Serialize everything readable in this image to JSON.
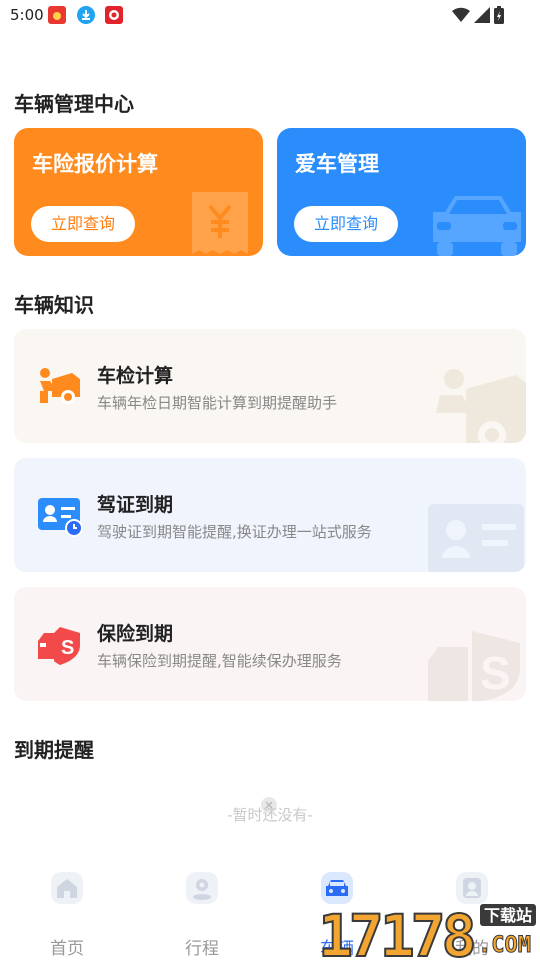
{
  "status_bar": {
    "time": "5:00"
  },
  "section_vehicle_mgmt": "车辆管理中心",
  "top_cards": [
    {
      "title": "车险报价计算",
      "button": "立即查询",
      "color": "#ff8a1e"
    },
    {
      "title": "爱车管理",
      "button": "立即查询",
      "color": "#2b8dfc"
    }
  ],
  "section_knowledge": "车辆知识",
  "knowledge_cards": [
    {
      "title": "车检计算",
      "desc": "车辆年检日期智能计算到期提醒助手",
      "icon": "car-repair-icon",
      "bg": "#faf7f2"
    },
    {
      "title": "驾证到期",
      "desc": "驾驶证到期智能提醒,换证办理一站式服务",
      "icon": "license-card-icon",
      "bg": "#eff4fd"
    },
    {
      "title": "保险到期",
      "desc": "车辆保险到期提醒,智能续保办理服务",
      "icon": "insurance-shield-icon",
      "bg": "#faf5f4"
    }
  ],
  "section_reminder": "到期提醒",
  "empty_text": "-暂时还没有-",
  "bottom_nav": [
    {
      "label": "首页",
      "icon": "home-icon",
      "active": false
    },
    {
      "label": "行程",
      "icon": "location-icon",
      "active": false
    },
    {
      "label": "车辆",
      "icon": "car-icon",
      "active": true
    },
    {
      "label": "我的",
      "icon": "user-icon",
      "active": false
    }
  ],
  "watermark": {
    "number": "17178",
    "tag": "下载站",
    "suffix": ".COM"
  }
}
